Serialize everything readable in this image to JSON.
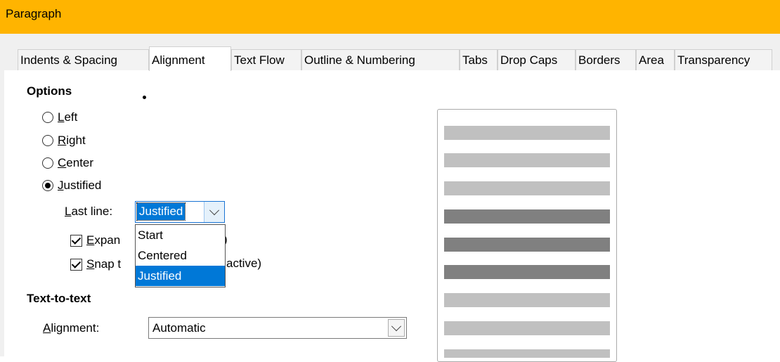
{
  "window": {
    "title": "Paragraph"
  },
  "tabs": [
    {
      "label": "Indents & Spacing",
      "active": false
    },
    {
      "label": "Alignment",
      "active": true
    },
    {
      "label": "Text Flow",
      "active": false
    },
    {
      "label": "Outline & Numbering",
      "active": false
    },
    {
      "label": "Tabs",
      "active": false
    },
    {
      "label": "Drop Caps",
      "active": false
    },
    {
      "label": "Borders",
      "active": false
    },
    {
      "label": "Area",
      "active": false
    },
    {
      "label": "Transparency",
      "active": false
    }
  ],
  "options": {
    "heading": "Options",
    "radios": [
      {
        "first": "L",
        "rest": "eft",
        "checked": false
      },
      {
        "first": "R",
        "rest": "ight",
        "checked": false
      },
      {
        "first": "C",
        "rest": "enter",
        "checked": false
      },
      {
        "first": "J",
        "rest": "ustified",
        "checked": true
      }
    ],
    "last_line": {
      "label_first": "L",
      "label_rest": "ast line:",
      "value": "Justified",
      "options": [
        "Start",
        "Centered",
        "Justified"
      ],
      "selected_option": "Justified"
    },
    "expand_single_word": {
      "first": "E",
      "rest": "xpan",
      "trailing": ")",
      "checked": true
    },
    "snap_to_grid": {
      "first": "S",
      "rest": "nap t",
      "trailing": "active)",
      "checked": true
    }
  },
  "text_to_text": {
    "heading": "Text-to-text",
    "alignment_label_first": "A",
    "alignment_label_rest": "lignment:",
    "alignment_value": "Automatic"
  },
  "preview": {
    "lines": [
      "light",
      "light",
      "light",
      "dark",
      "dark",
      "dark",
      "light",
      "light",
      "light",
      "light"
    ],
    "colors": {
      "light": "#c0c0c0",
      "dark": "#808080"
    }
  },
  "colors": {
    "title_bar": "#ffb400",
    "selection": "#0078d7"
  }
}
